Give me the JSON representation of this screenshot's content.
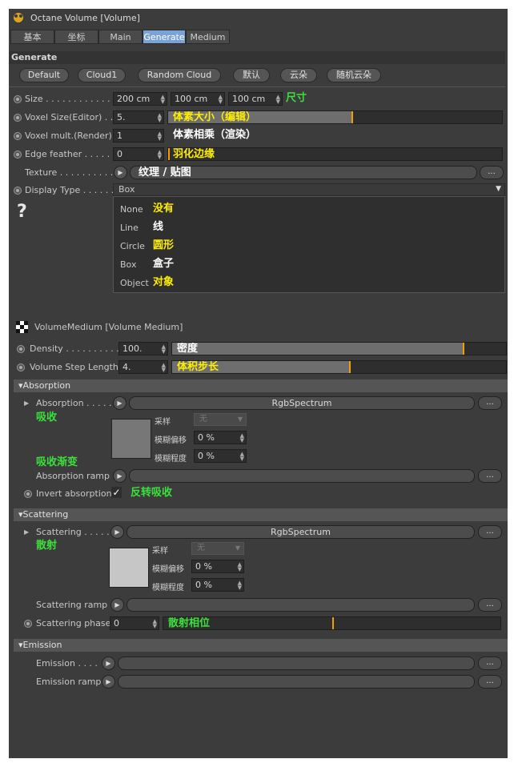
{
  "window": {
    "title": "Octane Volume [Volume]"
  },
  "tabs": [
    {
      "label": "基本"
    },
    {
      "label": "坐标"
    },
    {
      "label": "Main"
    },
    {
      "label": "Generate"
    },
    {
      "label": "Medium"
    }
  ],
  "generate": {
    "header": "Generate",
    "presets": [
      "Default",
      "Cloud1",
      "Random Cloud",
      "默认",
      "云朵",
      "随机云朵"
    ],
    "size": {
      "label": "Size",
      "x": "200 cm",
      "y": "100 cm",
      "z": "100 cm",
      "note": "尺寸"
    },
    "voxel_size": {
      "label": "Voxel Size(Editor)",
      "value": "5.",
      "note": "体素大小（编辑）",
      "level": 0.55
    },
    "voxel_mult": {
      "label": "Voxel mult.(Render)",
      "value": "1",
      "note": "体素相乘（渲染）"
    },
    "edge_feather": {
      "label": "Edge feather",
      "value": "0",
      "note": "羽化边缘",
      "level": 0
    },
    "texture": {
      "label": "Texture",
      "note": "纹理 / 贴图",
      "more": "..."
    },
    "display_type": {
      "label": "Display Type",
      "selected": "Box",
      "options": [
        {
          "en": "None",
          "zh": "没有"
        },
        {
          "en": "Line",
          "zh": "线"
        },
        {
          "en": "Circle",
          "zh": "圆形"
        },
        {
          "en": "Box",
          "zh": "盒子"
        },
        {
          "en": "Object",
          "zh": "对象"
        }
      ]
    },
    "help": "?"
  },
  "medium": {
    "title": "VolumeMedium [Volume Medium]",
    "density": {
      "label": "Density",
      "value": "100.",
      "note": "密度",
      "level": 0.87
    },
    "step_length": {
      "label": "Volume Step Length",
      "value": "4.",
      "note": "体积步长",
      "level": 0.53
    }
  },
  "absorption": {
    "header": "Absorption",
    "label": "Absorption",
    "shader": "RgbSpectrum",
    "note": "吸收",
    "more": "...",
    "color": "#777777",
    "sample_label": "采样",
    "sample_value": "无",
    "blur_offset_label": "模糊偏移",
    "blur_offset": "0 %",
    "blur_scale_label": "模糊程度",
    "blur_scale": "0 %",
    "ramp_note": "吸收渐变",
    "ramp_label": "Absorption ramp",
    "invert_label": "Invert absorption",
    "invert_check": "✓",
    "invert_note": "反转吸收"
  },
  "scattering": {
    "header": "Scattering",
    "label": "Scattering",
    "shader": "RgbSpectrum",
    "note": "散射",
    "more": "...",
    "color": "#c6c6c6",
    "sample_label": "采样",
    "sample_value": "无",
    "blur_offset_label": "模糊偏移",
    "blur_offset": "0 %",
    "blur_scale_label": "模糊程度",
    "blur_scale": "0 %",
    "ramp_label": "Scattering ramp",
    "phase_label": "Scattering phase",
    "phase_value": "0",
    "phase_note": "散射相位",
    "phase_level": 0.5
  },
  "emission": {
    "header": "Emission",
    "label": "Emission",
    "ramp_label": "Emission ramp",
    "more": "..."
  }
}
